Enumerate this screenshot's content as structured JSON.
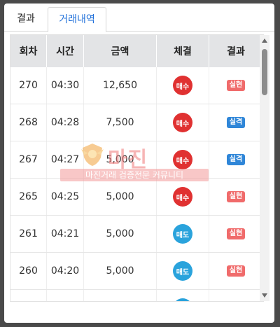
{
  "tabs": [
    {
      "label": "결과",
      "active": false
    },
    {
      "label": "거래내역",
      "active": true
    }
  ],
  "table": {
    "headers": [
      "회차",
      "시간",
      "금액",
      "체결",
      "결과"
    ],
    "rows": [
      {
        "round": "270",
        "time": "04:30",
        "amount": "12,650",
        "trade": "매수",
        "trade_color": "#e03131",
        "result": "실현",
        "result_color": "#f06b6b"
      },
      {
        "round": "268",
        "time": "04:28",
        "amount": "7,500",
        "trade": "매수",
        "trade_color": "#e03131",
        "result": "실격",
        "result_color": "#2f86d8"
      },
      {
        "round": "267",
        "time": "04:27",
        "amount": "5,000",
        "trade": "매수",
        "trade_color": "#e03131",
        "result": "실격",
        "result_color": "#2f86d8"
      },
      {
        "round": "265",
        "time": "04:25",
        "amount": "5,000",
        "trade": "매수",
        "trade_color": "#e03131",
        "result": "실현",
        "result_color": "#f06b6b"
      },
      {
        "round": "261",
        "time": "04:21",
        "amount": "5,000",
        "trade": "매도",
        "trade_color": "#2aa3dc",
        "result": "실현",
        "result_color": "#f06b6b"
      },
      {
        "round": "260",
        "time": "04:20",
        "amount": "5,000",
        "trade": "매도",
        "trade_color": "#2aa3dc",
        "result": "실현",
        "result_color": "#f06b6b"
      },
      {
        "round": "",
        "time": "",
        "amount": "",
        "trade": "",
        "trade_color": "#2aa3dc",
        "result": "",
        "result_color": "#f06b6b"
      }
    ]
  },
  "watermark": {
    "title": "마진",
    "subtitle": "마진거래 검증전문 커뮤니티"
  }
}
